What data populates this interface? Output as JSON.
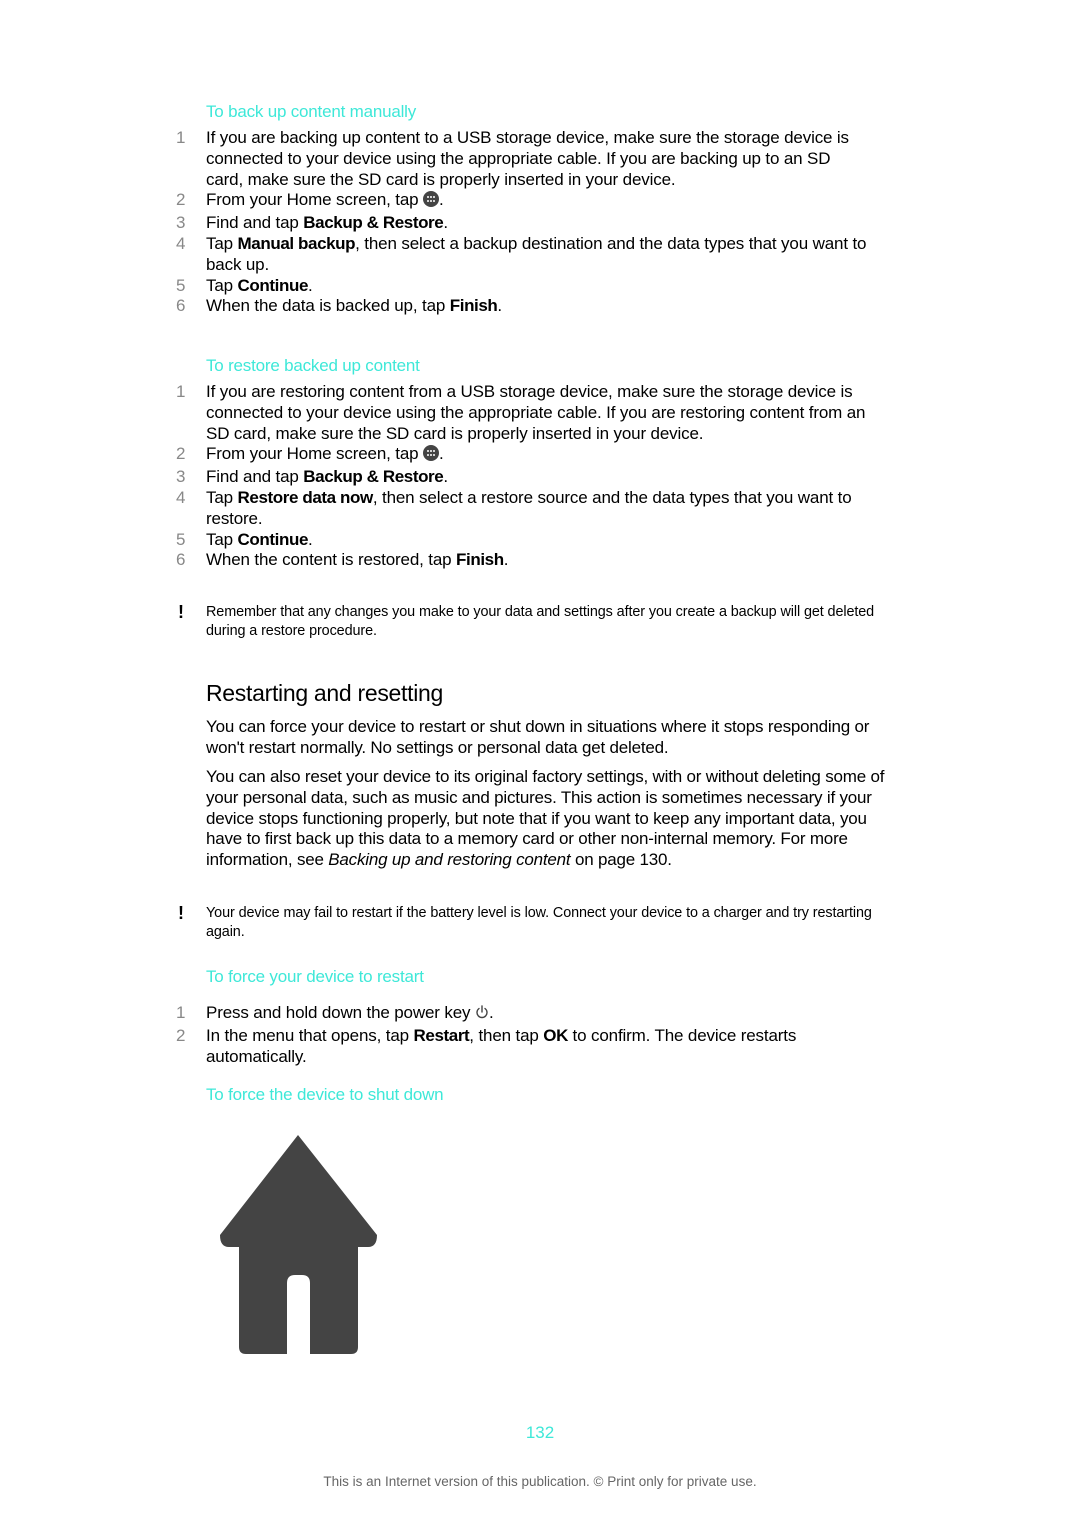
{
  "sections": {
    "backup": {
      "heading": "To back up content manually",
      "steps": [
        {
          "num": "1",
          "text": "If you are backing up content to a USB storage device, make sure the storage device is connected to your device using the appropriate cable. If you are backing up to an SD card, make sure the SD card is properly inserted in your device."
        },
        {
          "num": "2",
          "pre": "From your Home screen, tap ",
          "icon": "app-drawer-icon",
          "post": "."
        },
        {
          "num": "3",
          "pre": "Find and tap ",
          "bold": "Backup & Restore",
          "post": "."
        },
        {
          "num": "4",
          "pre": "Tap ",
          "bold": "Manual backup",
          "post": ", then select a backup destination and the data types that you want to back up."
        },
        {
          "num": "5",
          "pre": "Tap ",
          "bold": "Continue",
          "post": "."
        },
        {
          "num": "6",
          "pre": "When the data is backed up, tap ",
          "bold": "Finish",
          "post": "."
        }
      ]
    },
    "restore": {
      "heading": "To restore backed up content",
      "steps": [
        {
          "num": "1",
          "text": "If you are restoring content from a USB storage device, make sure the storage device is connected to your device using the appropriate cable. If you are restoring content from an SD card, make sure the SD card is properly inserted in your device."
        },
        {
          "num": "2",
          "pre": "From your Home screen, tap ",
          "icon": "app-drawer-icon",
          "post": "."
        },
        {
          "num": "3",
          "pre": "Find and tap ",
          "bold": "Backup & Restore",
          "post": "."
        },
        {
          "num": "4",
          "pre": "Tap ",
          "bold": "Restore data now",
          "post": ", then select a restore source and the data types that you want to restore."
        },
        {
          "num": "5",
          "pre": "Tap ",
          "bold": "Continue",
          "post": "."
        },
        {
          "num": "6",
          "pre": "When the content is restored, tap ",
          "bold": "Finish",
          "post": "."
        }
      ],
      "note": "Remember that any changes you make to your data and settings after you create a backup will get deleted during a restore procedure."
    },
    "restarting": {
      "title": "Restarting and resetting",
      "para1": "You can force your device to restart or shut down in situations where it stops responding or won't restart normally. No settings or personal data get deleted.",
      "para2_pre": "You can also reset your device to its original factory settings, with or without deleting some of your personal data, such as music and pictures. This action is sometimes necessary if your device stops functioning properly, but note that if you want to keep any important data, you have to first back up this data to a memory card or other non-internal memory. For more information, see ",
      "para2_link": "Backing up and restoring content",
      "para2_post": " on page 130.",
      "note": "Your device may fail to restart if the battery level is low. Connect your device to a charger and try restarting again."
    },
    "force_restart": {
      "heading": "To force your device to restart",
      "steps": [
        {
          "num": "1",
          "pre": "Press and hold down the power key ",
          "icon": "power-icon",
          "post": "."
        },
        {
          "num": "2",
          "pre": "In the menu that opens, tap ",
          "bold": "Restart",
          "mid": ", then tap ",
          "bold2": "OK",
          "post": " to confirm. The device restarts automatically."
        }
      ]
    },
    "force_shutdown": {
      "heading": "To force the device to shut down",
      "figure_icon": "home-icon"
    }
  },
  "page_number": "132",
  "footer": "This is an Internet version of this publication. © Print only for private use.",
  "colors": {
    "accent": "#3ee8d8",
    "text": "#000000",
    "step_number": "#888888",
    "icon": "#444444"
  }
}
